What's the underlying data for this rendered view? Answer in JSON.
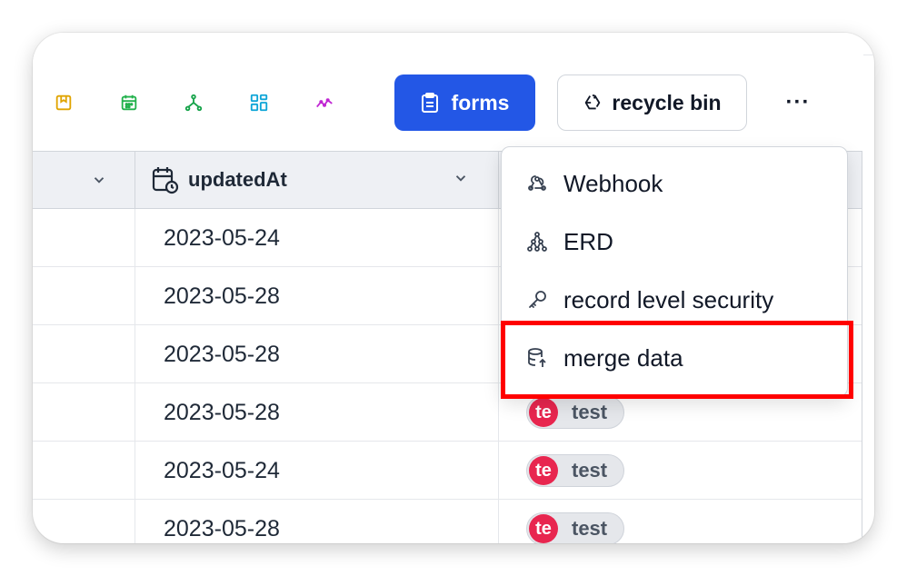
{
  "toolbar": {
    "icons": [
      "kanban-icon",
      "calendar-icon",
      "graph-icon",
      "layout-icon",
      "chart-line-icon"
    ],
    "forms_label": "forms",
    "recycle_label": "recycle bin",
    "more_label": "···"
  },
  "table": {
    "columns": [
      {
        "label": "",
        "icon": "chevron-down-icon"
      },
      {
        "label": "updatedAt",
        "icon": "calendar-clock-icon"
      },
      {
        "label": ""
      }
    ],
    "rows": [
      {
        "date": "2023-05-24",
        "tag": null
      },
      {
        "date": "2023-05-28",
        "tag": null
      },
      {
        "date": "2023-05-28",
        "tag": null
      },
      {
        "date": "2023-05-28",
        "tag": {
          "avatar": "te",
          "text": "test"
        }
      },
      {
        "date": "2023-05-24",
        "tag": {
          "avatar": "te",
          "text": "test"
        }
      },
      {
        "date": "2023-05-28",
        "tag": {
          "avatar": "te",
          "text": "test"
        }
      }
    ]
  },
  "menu": {
    "items": [
      {
        "label": "Webhook",
        "icon": "webhook-icon"
      },
      {
        "label": "ERD",
        "icon": "erd-icon"
      },
      {
        "label": "record level security",
        "icon": "key-icon"
      },
      {
        "label": "merge data",
        "icon": "database-upload-icon"
      }
    ],
    "highlighted_index": 3
  },
  "colors": {
    "primary": "#2357e6",
    "avatar": "#e8264f",
    "highlight": "#ff0000"
  }
}
